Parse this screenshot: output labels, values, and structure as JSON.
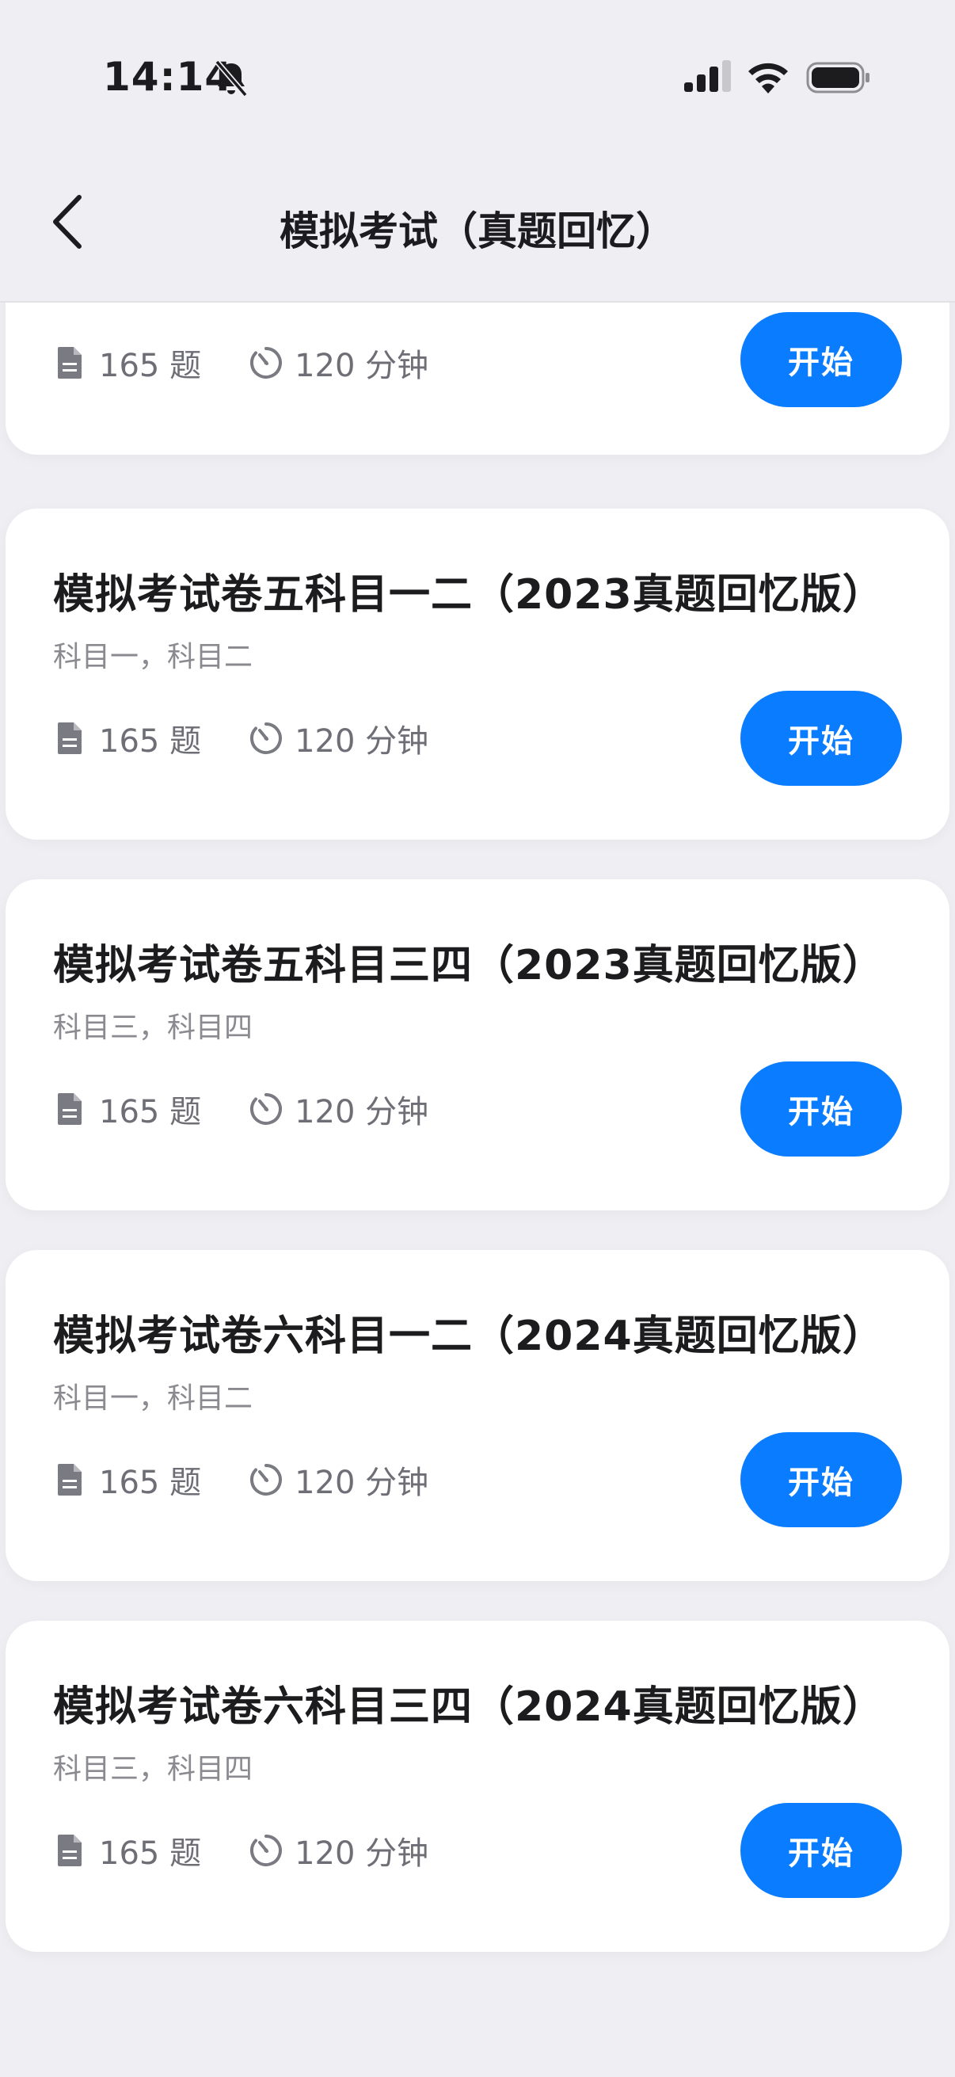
{
  "status": {
    "time": "14:14"
  },
  "header": {
    "title": "模拟考试（真题回忆）"
  },
  "cards": [
    {
      "title": "",
      "subtitle": "",
      "questions": "165 题",
      "duration": "120 分钟",
      "start_label": "开始"
    },
    {
      "title": "模拟考试卷五科目一二（2023真题回忆版）",
      "subtitle": "科目一，科目二",
      "questions": "165 题",
      "duration": "120 分钟",
      "start_label": "开始"
    },
    {
      "title": "模拟考试卷五科目三四（2023真题回忆版）",
      "subtitle": "科目三，科目四",
      "questions": "165 题",
      "duration": "120 分钟",
      "start_label": "开始"
    },
    {
      "title": "模拟考试卷六科目一二（2024真题回忆版）",
      "subtitle": "科目一，科目二",
      "questions": "165 题",
      "duration": "120 分钟",
      "start_label": "开始"
    },
    {
      "title": "模拟考试卷六科目三四（2024真题回忆版）",
      "subtitle": "科目三，科目四",
      "questions": "165 题",
      "duration": "120 分钟",
      "start_label": "开始"
    }
  ],
  "colors": {
    "accent": "#0a7cff",
    "background": "#eeeef3",
    "card": "#ffffff",
    "muted": "#6e6e76"
  },
  "icons": [
    "chevron-left-icon",
    "bell-slash-icon",
    "signal-icon",
    "wifi-icon",
    "battery-icon",
    "document-icon",
    "timer-icon"
  ]
}
